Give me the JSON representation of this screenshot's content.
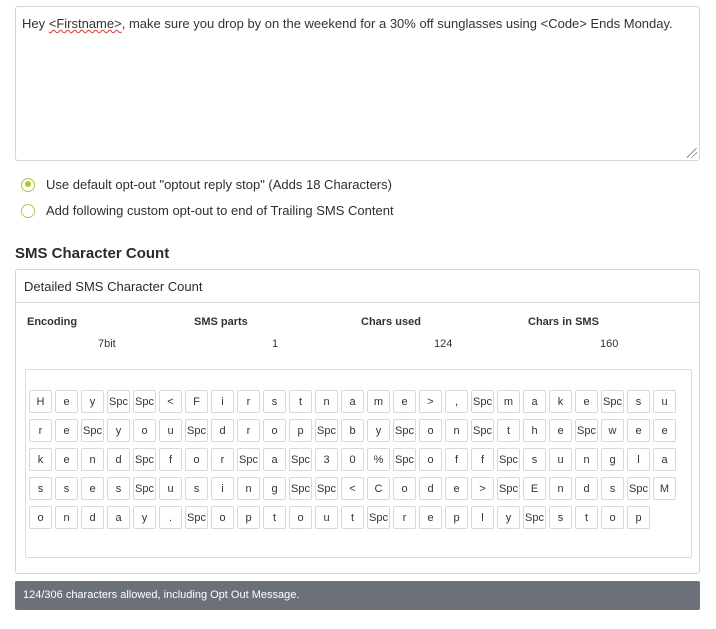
{
  "message": {
    "part1": "Hey  ",
    "firstname": "<Firstname>",
    "part2": ", make sure you drop by on the weekend for a 30% off sunglasses using  <Code> Ends Monday."
  },
  "optout": {
    "default_label": "Use default opt-out \"optout reply stop\" (Adds 18 Characters)",
    "custom_label": "Add following custom opt-out to end of Trailing SMS Content",
    "selected": "default"
  },
  "section_title": "SMS Character Count",
  "panel": {
    "title": "Detailed SMS Character Count",
    "stats": {
      "encoding_label": "Encoding",
      "encoding_value": "7bit",
      "parts_label": "SMS parts",
      "parts_value": "1",
      "used_label": "Chars used",
      "used_value": "124",
      "insms_label": "Chars in SMS",
      "insms_value": "160"
    }
  },
  "char_rows": [
    [
      "H",
      "e",
      "y",
      "Spc",
      "Spc",
      "<",
      "F",
      "i",
      "r",
      "s",
      "t",
      "n",
      "a",
      "m",
      "e",
      ">",
      ",",
      "Spc",
      "m",
      "a",
      "k",
      "e",
      "Spc",
      "s",
      "u"
    ],
    [
      "r",
      "e",
      "Spc",
      "y",
      "o",
      "u",
      "Spc",
      "d",
      "r",
      "o",
      "p",
      "Spc",
      "b",
      "y",
      "Spc",
      "o",
      "n",
      "Spc",
      "t",
      "h",
      "e",
      "Spc",
      "w",
      "e",
      "e"
    ],
    [
      "k",
      "e",
      "n",
      "d",
      "Spc",
      "f",
      "o",
      "r",
      "Spc",
      "a",
      "Spc",
      "3",
      "0",
      "%",
      "Spc",
      "o",
      "f",
      "f",
      "Spc",
      "s",
      "u",
      "n",
      "g",
      "l",
      "a"
    ],
    [
      "s",
      "s",
      "e",
      "s",
      "Spc",
      "u",
      "s",
      "i",
      "n",
      "g",
      "Spc",
      "Spc",
      "<",
      "C",
      "o",
      "d",
      "e",
      ">",
      "Spc",
      "E",
      "n",
      "d",
      "s",
      "Spc",
      "M"
    ],
    [
      "o",
      "n",
      "d",
      "a",
      "y",
      ".",
      "Spc",
      "o",
      "p",
      "t",
      "o",
      "u",
      "t",
      "Spc",
      "r",
      "e",
      "p",
      "l",
      "y",
      "Spc",
      "s",
      "t",
      "o",
      "p"
    ]
  ],
  "footer_text": "124/306 characters allowed, including Opt Out Message.",
  "colors": {
    "radio_accent": "#a8c83a",
    "footer_bg": "#6c7079"
  }
}
